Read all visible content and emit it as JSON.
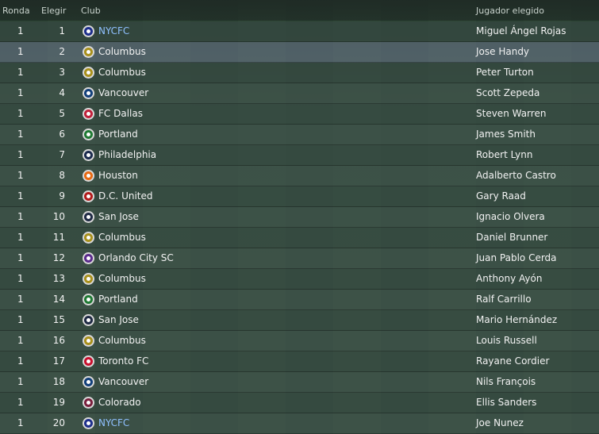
{
  "headers": {
    "round": "Ronda",
    "pick": "Elegir",
    "club": "Club",
    "player": "Jugador elegido"
  },
  "rows": [
    {
      "round": "1",
      "pick": "1",
      "club": "NYCFC",
      "player": "Miguel Ángel Rojas",
      "crest_color": "#1e2f8c",
      "link": true
    },
    {
      "round": "1",
      "pick": "2",
      "club": "Columbus",
      "player": "Jose Handy",
      "crest_color": "#a8901c",
      "link": false
    },
    {
      "round": "1",
      "pick": "3",
      "club": "Columbus",
      "player": "Peter Turton",
      "crest_color": "#a8901c",
      "link": false
    },
    {
      "round": "1",
      "pick": "4",
      "club": "Vancouver",
      "player": "Scott Zepeda",
      "crest_color": "#123f7a",
      "link": false
    },
    {
      "round": "1",
      "pick": "5",
      "club": "FC Dallas",
      "player": "Steven Warren",
      "crest_color": "#c0203a",
      "link": false
    },
    {
      "round": "1",
      "pick": "6",
      "club": "Portland",
      "player": "James Smith",
      "crest_color": "#1f7a33",
      "link": false
    },
    {
      "round": "1",
      "pick": "7",
      "club": "Philadelphia",
      "player": "Robert Lynn",
      "crest_color": "#1b2b4e",
      "link": false
    },
    {
      "round": "1",
      "pick": "8",
      "club": "Houston",
      "player": "Adalberto Castro",
      "crest_color": "#e86a12",
      "link": false
    },
    {
      "round": "1",
      "pick": "9",
      "club": "D.C. United",
      "player": "Gary Raad",
      "crest_color": "#b31b1b",
      "link": false
    },
    {
      "round": "1",
      "pick": "10",
      "club": "San Jose",
      "player": "Ignacio Olvera",
      "crest_color": "#1f2a44",
      "link": false
    },
    {
      "round": "1",
      "pick": "11",
      "club": "Columbus",
      "player": "Daniel Brunner",
      "crest_color": "#a8901c",
      "link": false
    },
    {
      "round": "1",
      "pick": "12",
      "club": "Orlando City SC",
      "player": "Juan Pablo Cerda",
      "crest_color": "#5b2b8c",
      "link": false
    },
    {
      "round": "1",
      "pick": "13",
      "club": "Columbus",
      "player": "Anthony Ayón",
      "crest_color": "#a8901c",
      "link": false
    },
    {
      "round": "1",
      "pick": "14",
      "club": "Portland",
      "player": "Ralf Carrillo",
      "crest_color": "#1f7a33",
      "link": false
    },
    {
      "round": "1",
      "pick": "15",
      "club": "San Jose",
      "player": "Mario Hernández",
      "crest_color": "#1f2a44",
      "link": false
    },
    {
      "round": "1",
      "pick": "16",
      "club": "Columbus",
      "player": "Louis Russell",
      "crest_color": "#a8901c",
      "link": false
    },
    {
      "round": "1",
      "pick": "17",
      "club": "Toronto FC",
      "player": "Rayane Cordier",
      "crest_color": "#c8102e",
      "link": false
    },
    {
      "round": "1",
      "pick": "18",
      "club": "Vancouver",
      "player": "Nils François",
      "crest_color": "#123f7a",
      "link": false
    },
    {
      "round": "1",
      "pick": "19",
      "club": "Colorado",
      "player": "Ellis Sanders",
      "crest_color": "#7a1f3d",
      "link": false
    },
    {
      "round": "1",
      "pick": "20",
      "club": "NYCFC",
      "player": "Joe Nunez",
      "crest_color": "#1e2f8c",
      "link": true
    }
  ],
  "highlighted_row": 1
}
